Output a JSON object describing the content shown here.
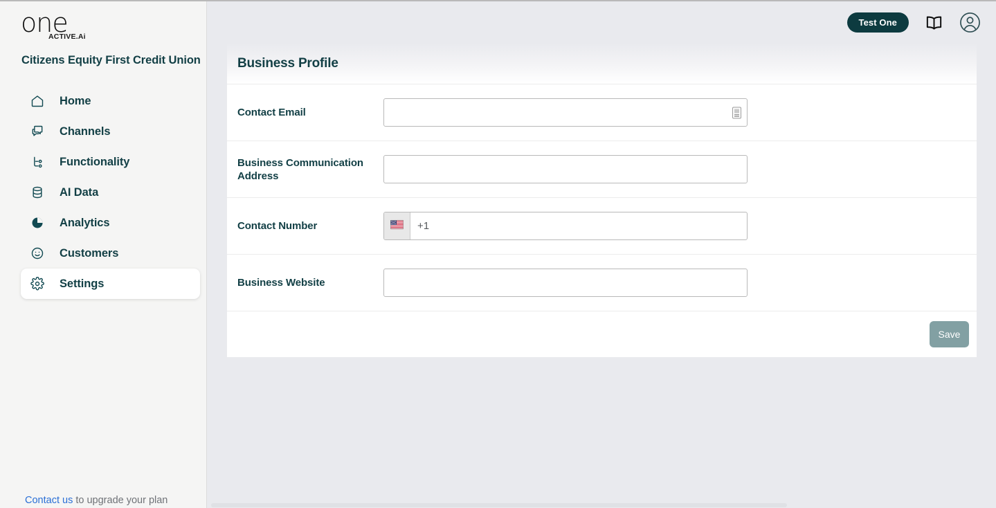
{
  "brand": {
    "logo_text": "one",
    "logo_subtext": "ACTIVE.Ai",
    "org_name": "Citizens Equity First Credit Union",
    "accent_dark": "#0d3b40",
    "accent_teal": "#123f45",
    "link_blue": "#2a6fd6",
    "disabled_button": "#82a0a3",
    "page_bg": "#e9eaee",
    "sidebar_bg": "#f5f5f4"
  },
  "sidebar": {
    "items": [
      {
        "label": "Home",
        "icon": "home-icon",
        "active": false
      },
      {
        "label": "Channels",
        "icon": "chat-bubbles-icon",
        "active": false
      },
      {
        "label": "Functionality",
        "icon": "flow-branch-icon",
        "active": false
      },
      {
        "label": "AI Data",
        "icon": "database-icon",
        "active": false
      },
      {
        "label": "Analytics",
        "icon": "pie-chart-icon",
        "active": false
      },
      {
        "label": "Customers",
        "icon": "smiley-face-icon",
        "active": false
      },
      {
        "label": "Settings",
        "icon": "gear-icon",
        "active": true
      }
    ],
    "footer": {
      "link_text": "Contact us",
      "rest_text": " to upgrade your plan"
    }
  },
  "header": {
    "account_button": "Test One",
    "icons": [
      {
        "name": "book-icon"
      },
      {
        "name": "user-avatar-icon"
      }
    ]
  },
  "main": {
    "panel_title": "Business Profile",
    "fields": [
      {
        "label": "Contact Email",
        "value": "",
        "placeholder": "",
        "type": "text",
        "trailing_icon": "contact-card-icon"
      },
      {
        "label": "Business Communication Address",
        "value": "",
        "placeholder": "",
        "type": "text",
        "trailing_icon": ""
      },
      {
        "label": "Contact Number",
        "value": "",
        "placeholder": "+1",
        "type": "phone",
        "country_flag": "us-flag-icon",
        "dial_code": "+1"
      },
      {
        "label": "Business Website",
        "value": "",
        "placeholder": "",
        "type": "text",
        "trailing_icon": ""
      }
    ],
    "save_label": "Save"
  }
}
